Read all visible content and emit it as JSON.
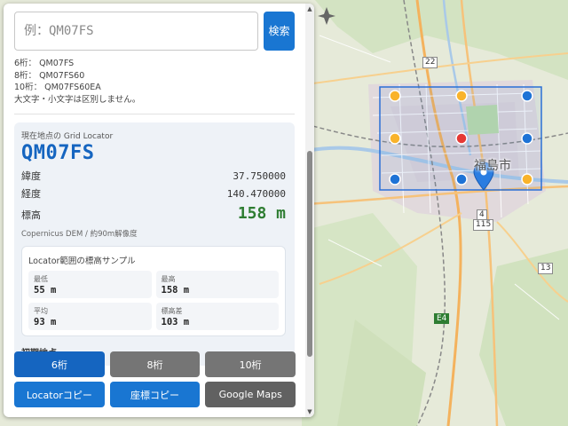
{
  "search": {
    "placeholder": "例：QM07FS",
    "button_label": "検索"
  },
  "hints": [
    "6桁： QM07FS",
    "8桁： QM07FS60",
    "10桁： QM07FS60EA",
    "大文字・小文字は区別しません。"
  ],
  "current": {
    "caption": "現在地点の Grid Locator",
    "locator": "QM07FS",
    "lat_label": "緯度",
    "lat_value": "37.750000",
    "lon_label": "経度",
    "lon_value": "140.470000",
    "elev_label": "標高",
    "elev_value": "158 m",
    "dem_note": "Copernicus DEM / 約90m解像度"
  },
  "samples": {
    "title": "Locator範囲の標高サンプル",
    "min_label": "最低",
    "min_value": "55 m",
    "max_label": "最高",
    "max_value": "158 m",
    "avg_label": "平均",
    "avg_value": "93 m",
    "diff_label": "標高差",
    "diff_value": "103 m"
  },
  "initial_point_label": "初期地点",
  "buttons": {
    "digits6": "6桁",
    "digits8": "8桁",
    "digits10": "10桁",
    "copy_locator": "Locatorコピー",
    "copy_coords": "座標コピー",
    "google_maps": "Google Maps"
  },
  "map": {
    "city_label": "福島市",
    "shields": [
      "22",
      "4",
      "115",
      "13",
      "E4"
    ],
    "marker_colors": {
      "high": "#e53935",
      "mid": "#f9b32b",
      "low": "#1e73d6"
    },
    "grid_color": "#2a6fd6"
  }
}
